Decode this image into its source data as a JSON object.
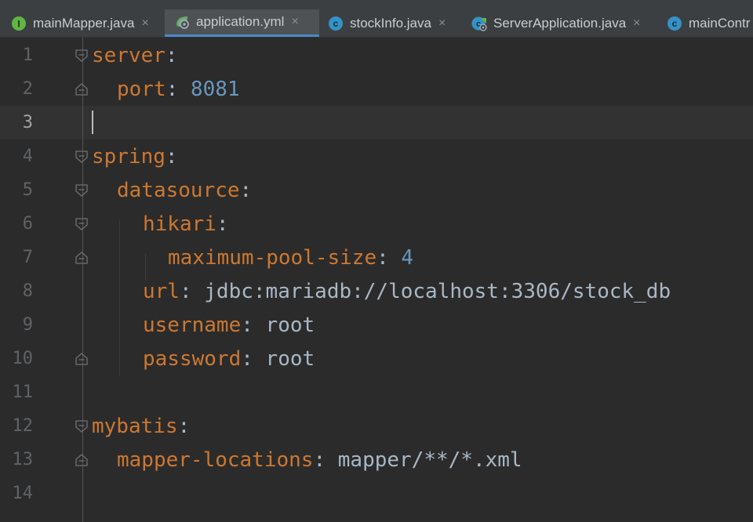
{
  "tabs": [
    {
      "label": "mainMapper.java",
      "icon": "interface-icon",
      "active": false
    },
    {
      "label": "application.yml",
      "icon": "spring-config-icon",
      "active": true
    },
    {
      "label": "stockInfo.java",
      "icon": "class-icon",
      "active": false
    },
    {
      "label": "ServerApplication.java",
      "icon": "spring-class-icon",
      "active": false
    },
    {
      "label": "mainContr",
      "icon": "class-icon",
      "active": false
    }
  ],
  "close_glyph": "×",
  "icon_letters": {
    "interface": "I",
    "class": "c"
  },
  "editor": {
    "current_line": 3,
    "lines": [
      {
        "no": "1",
        "key": "server",
        "colon": ":",
        "value": ""
      },
      {
        "no": "2",
        "key": "port",
        "colon": ":",
        "value": "8081",
        "numeric": true
      },
      {
        "no": "3",
        "key": "",
        "colon": "",
        "value": ""
      },
      {
        "no": "4",
        "key": "spring",
        "colon": ":",
        "value": ""
      },
      {
        "no": "5",
        "key": "datasource",
        "colon": ":",
        "value": ""
      },
      {
        "no": "6",
        "key": "hikari",
        "colon": ":",
        "value": ""
      },
      {
        "no": "7",
        "key": "maximum-pool-size",
        "colon": ":",
        "value": "4",
        "numeric": true
      },
      {
        "no": "8",
        "key": "url",
        "colon": ":",
        "value": "jdbc:mariadb://localhost:3306/stock_db"
      },
      {
        "no": "9",
        "key": "username",
        "colon": ":",
        "value": "root"
      },
      {
        "no": "10",
        "key": "password",
        "colon": ":",
        "value": "root"
      },
      {
        "no": "11",
        "key": "",
        "colon": "",
        "value": ""
      },
      {
        "no": "12",
        "key": "mybatis",
        "colon": ":",
        "value": ""
      },
      {
        "no": "13",
        "key": "mapper-locations",
        "colon": ":",
        "value": "mapper/**/*.xml"
      },
      {
        "no": "14",
        "key": "",
        "colon": "",
        "value": ""
      }
    ]
  },
  "colors": {
    "editor_bg": "#2b2b2b",
    "tabbar_bg": "#3c3f41",
    "active_tab_underline": "#4a88c7",
    "yaml_key": "#cc7832",
    "yaml_number": "#6897bb",
    "yaml_text": "#a9b7c6",
    "line_number": "#606366"
  }
}
